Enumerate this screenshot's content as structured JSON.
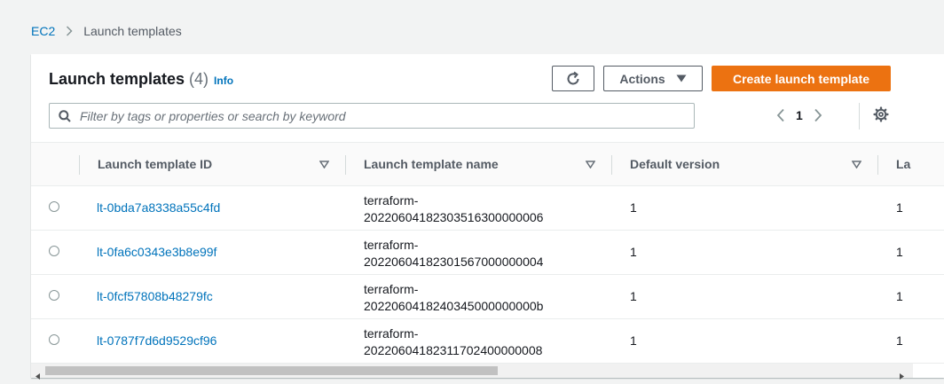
{
  "breadcrumb": {
    "root": "EC2",
    "current": "Launch templates"
  },
  "header": {
    "title": "Launch templates",
    "count": "(4)",
    "info": "Info",
    "actions_label": "Actions",
    "create_label": "Create launch template"
  },
  "filter": {
    "placeholder": "Filter by tags or properties or search by keyword"
  },
  "pagination": {
    "current_page": "1"
  },
  "table": {
    "columns": [
      "Launch template ID",
      "Launch template name",
      "Default version",
      "La"
    ],
    "rows": [
      {
        "id": "lt-0bda7a8338a55c4fd",
        "name_line1": "terraform-",
        "name_line2": "20220604182303516300000006",
        "default_version": "1",
        "latest_version": "1"
      },
      {
        "id": "lt-0fa6c0343e3b8e99f",
        "name_line1": "terraform-",
        "name_line2": "20220604182301567000000004",
        "default_version": "1",
        "latest_version": "1"
      },
      {
        "id": "lt-0fcf57808b48279fc",
        "name_line1": "terraform-",
        "name_line2": "2022060418240345000000000b",
        "default_version": "1",
        "latest_version": "1"
      },
      {
        "id": "lt-0787f7d6d9529cf96",
        "name_line1": "terraform-",
        "name_line2": "20220604182311702400000008",
        "default_version": "1",
        "latest_version": "1"
      }
    ]
  },
  "icons": {
    "breadcrumb_separator": "chevron-right-icon",
    "refresh": "refresh-icon",
    "actions_caret": "caret-down-icon",
    "search": "search-icon",
    "prev_page": "chevron-left-icon",
    "next_page": "chevron-right-icon",
    "settings": "gear-icon",
    "sort": "sort-caret-icon"
  },
  "colors": {
    "primary_button": "#ec7211",
    "link": "#0073bb",
    "page_background": "#f2f3f3",
    "text": "#16191f",
    "secondary_text": "#545b64"
  }
}
